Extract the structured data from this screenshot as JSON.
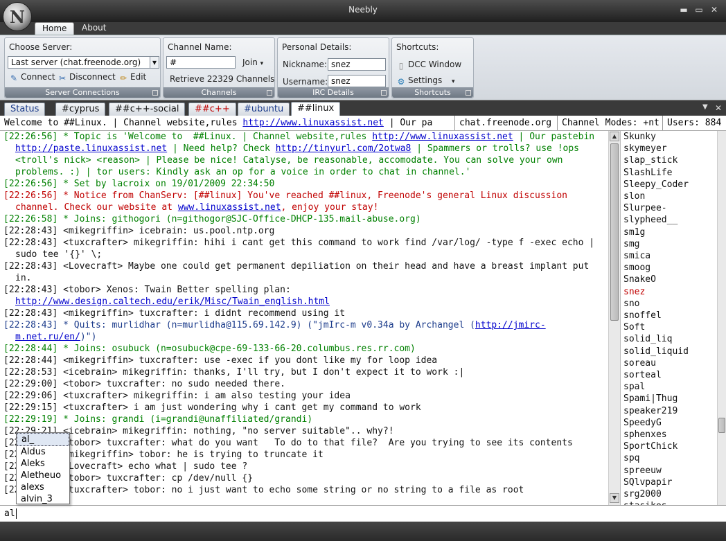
{
  "window": {
    "title": "Neebly",
    "logo_letter": "N",
    "minimize": "▬",
    "maximize": "▭",
    "close": "✕"
  },
  "ribbon_tabs": [
    {
      "label": "Home"
    },
    {
      "label": "About"
    }
  ],
  "server_group": {
    "title": "Choose Server:",
    "server_value": "Last server (chat.freenode.org)",
    "connect": "Connect",
    "disconnect": "Disconnect",
    "edit": "Edit",
    "footer": "Server Connections"
  },
  "channels_group": {
    "title": "Channel Name:",
    "channel_value": "#",
    "join": "Join",
    "retrieve": "Retrieve 22329 Channels",
    "footer": "Channels"
  },
  "details_group": {
    "title": "Personal Details:",
    "nickname_label": "Nickname:",
    "nickname_value": "snez",
    "username_label": "Username:",
    "username_value": "snez",
    "footer": "IRC Details"
  },
  "shortcuts_group": {
    "title": "Shortcuts:",
    "dcc": "DCC Window",
    "settings": "Settings",
    "footer": "Shortcuts"
  },
  "channel_tabs": [
    {
      "label": "Status",
      "color": "#1a3a8a"
    },
    {
      "label": "#cyprus",
      "color": "#111111"
    },
    {
      "label": "##c++-social",
      "color": "#111111"
    },
    {
      "label": "##c++",
      "color": "#c00000"
    },
    {
      "label": "#ubuntu",
      "color": "#1a3a8a"
    },
    {
      "label": "##linux",
      "color": "#111111"
    }
  ],
  "tabstrip_controls": {
    "dropdown": "▼",
    "close": "✕"
  },
  "topic": {
    "part1": "Welcome to  ##Linux. | Channel website,rules ",
    "link": "http://www.linuxassist.net",
    "part2": " | Our pa",
    "server": "chat.freenode.org",
    "modes": "Channel Modes: +nt",
    "users": "Users: 884"
  },
  "messages": [
    {
      "color": "#008000",
      "parts": [
        {
          "t": "[22:26:56] * Topic is 'Welcome to  ##Linux. | Channel website,rules "
        },
        {
          "t": "http://www.linuxassist.net",
          "link": true
        },
        {
          "t": " | Our pastebin "
        },
        {
          "t": "http://paste.linuxassist.net",
          "link": true
        },
        {
          "t": " | Need help? Check "
        },
        {
          "t": "http://tinyurl.com/2otwa8",
          "link": true
        },
        {
          "t": " | Spammers or trolls? use !ops <troll's nick> <reason> | Please be nice! Catalyse, be reasonable, accomodate. You can solve your own problems. :) | tor users: Kindly ask an op for a voice in order to chat in channel.'"
        }
      ]
    },
    {
      "color": "#008000",
      "parts": [
        {
          "t": "[22:26:56] * Set by lacroix on 19/01/2009 22:34:50"
        }
      ]
    },
    {
      "color": "#c00000",
      "parts": [
        {
          "t": "[22:26:56] * Notice from ChanServ: [##linux] You've reached ##linux, Freenode's general Linux discussion channel. Check our website at "
        },
        {
          "t": "www.linuxassist.net",
          "link": true
        },
        {
          "t": ", enjoy your stay!"
        }
      ]
    },
    {
      "color": "#008000",
      "parts": [
        {
          "t": "[22:26:58] * Joins: githogori (n=githogor@SJC-Office-DHCP-135.mail-abuse.org)"
        }
      ]
    },
    {
      "color": "#111111",
      "parts": [
        {
          "t": "[22:28:43] <mikegriffin> icebrain: us.pool.ntp.org"
        }
      ]
    },
    {
      "color": "#111111",
      "parts": [
        {
          "t": "[22:28:43] <tuxcrafter> mikegriffin: hihi i cant get this command to work find /var/log/ -type f -exec echo | sudo tee '{}' \\;"
        }
      ]
    },
    {
      "color": "#111111",
      "parts": [
        {
          "t": "[22:28:43] <Lovecraft> Maybe one could get permanent depiliation on their head and have a breast implant put in."
        }
      ]
    },
    {
      "color": "#111111",
      "parts": [
        {
          "t": "[22:28:43] <tobor> Xenos: Twain Better spelling plan: "
        },
        {
          "t": "http://www.design.caltech.edu/erik/Misc/Twain_english.html",
          "link": true
        }
      ]
    },
    {
      "color": "#111111",
      "parts": [
        {
          "t": "[22:28:43] <mikegriffin> tuxcrafter: i didnt recommend using it"
        }
      ]
    },
    {
      "color": "#1a3a8a",
      "parts": [
        {
          "t": "[22:28:43] * Quits: murlidhar (n=murlidha@115.69.142.9) (\"jmIrc-m v0.34a by Archangel ("
        },
        {
          "t": "http://jmirc-m.net.ru/en/",
          "link": true
        },
        {
          "t": ")\")"
        }
      ]
    },
    {
      "color": "#008000",
      "parts": [
        {
          "t": "[22:28:44] * Joins: osubuck (n=osubuck@cpe-69-133-66-20.columbus.res.rr.com)"
        }
      ]
    },
    {
      "color": "#111111",
      "parts": [
        {
          "t": "[22:28:44] <mikegriffin> tuxcrafter: use -exec if you dont like my for loop idea"
        }
      ]
    },
    {
      "color": "#111111",
      "parts": [
        {
          "t": "[22:28:53] <icebrain> mikegriffin: thanks, I'll try, but I don't expect it to work :|"
        }
      ]
    },
    {
      "color": "#111111",
      "parts": [
        {
          "t": "[22:29:00] <tobor> tuxcrafter: no sudo needed there."
        }
      ]
    },
    {
      "color": "#111111",
      "parts": [
        {
          "t": "[22:29:06] <tuxcrafter> mikegriffin: i am also testing your idea"
        }
      ]
    },
    {
      "color": "#111111",
      "parts": [
        {
          "t": "[22:29:15] <tuxcrafter> i am just wondering why i cant get my command to work"
        }
      ]
    },
    {
      "color": "#008000",
      "parts": [
        {
          "t": "[22:29:19] * Joins: grandi (i=grandi@unaffiliated/grandi)"
        }
      ]
    },
    {
      "color": "#111111",
      "parts": [
        {
          "t": "[22:29:21] <icebrain> mikegriffin: nothing, \"no server suitable\".. why?!"
        }
      ]
    },
    {
      "color": "#111111",
      "parts": [
        {
          "t": "[22:29:25] <tobor> tuxcrafter: what do you want   To do to that file?  Are you trying to see its contents"
        }
      ]
    },
    {
      "color": "#111111",
      "parts": [
        {
          "t": "[22:29:31] <mikegriffin> tobor: he is trying to truncate it"
        }
      ]
    },
    {
      "color": "#111111",
      "parts": [
        {
          "t": "[22:29:33] <Lovecraft> echo what | sudo tee ?"
        }
      ]
    },
    {
      "color": "#111111",
      "parts": [
        {
          "t": "[22:29:38] <tobor> tuxcrafter: cp /dev/null {}"
        }
      ]
    },
    {
      "color": "#111111",
      "parts": [
        {
          "t": "[22:29:44] <tuxcrafter> tobor: no i just want to echo some string or no string to a file as root"
        }
      ]
    }
  ],
  "users": [
    {
      "nick": "Skunky"
    },
    {
      "nick": "skymeyer"
    },
    {
      "nick": "slap_stick"
    },
    {
      "nick": "SlashLife"
    },
    {
      "nick": "Sleepy_Coder"
    },
    {
      "nick": "slon"
    },
    {
      "nick": "Slurpee-"
    },
    {
      "nick": "slypheed__"
    },
    {
      "nick": "sm1g"
    },
    {
      "nick": "smg"
    },
    {
      "nick": "smica"
    },
    {
      "nick": "smoog"
    },
    {
      "nick": "SnakeO"
    },
    {
      "nick": "snez",
      "self": true
    },
    {
      "nick": "sno"
    },
    {
      "nick": "snoffel"
    },
    {
      "nick": "Soft"
    },
    {
      "nick": "solid_liq"
    },
    {
      "nick": "solid_liquid"
    },
    {
      "nick": "soreau"
    },
    {
      "nick": "sorteal"
    },
    {
      "nick": "spal"
    },
    {
      "nick": "Spami|Thug"
    },
    {
      "nick": "speaker219"
    },
    {
      "nick": "SpeedyG"
    },
    {
      "nick": "sphenxes"
    },
    {
      "nick": "SportChick"
    },
    {
      "nick": "spq"
    },
    {
      "nick": "spreeuw"
    },
    {
      "nick": "SQlvpapir"
    },
    {
      "nick": "srg2000"
    },
    {
      "nick": "stasikos"
    }
  ],
  "autocomplete": [
    "al_",
    "Aldus",
    "Aleks",
    "Aletheuo",
    "alexs",
    "alvin_3"
  ],
  "input": {
    "value": "al"
  },
  "scroll_glyphs": {
    "up": "▲",
    "down": "▼"
  },
  "dropdown_glyph": "▾",
  "colors": {
    "accent": "#8f98a3",
    "self_nick": "#c00000",
    "join": "#008000",
    "link": "#0000cc"
  }
}
